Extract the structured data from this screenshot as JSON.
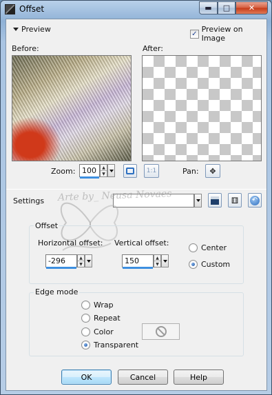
{
  "window": {
    "title": "Offset"
  },
  "preview": {
    "toggle_label": "Preview",
    "preview_on_image_label": "Preview on Image",
    "preview_on_image_checked": true,
    "before_label": "Before:",
    "after_label": "After:"
  },
  "zoom": {
    "label": "Zoom:",
    "value": "100",
    "fit_icon": "fit-to-window-icon",
    "actual_label": "1:1"
  },
  "pan": {
    "label": "Pan:",
    "icon": "move-arrows-icon"
  },
  "settings": {
    "label": "Settings",
    "preset_value": ""
  },
  "watermark": {
    "text": "Arte by_ Neusa Novaes"
  },
  "offset": {
    "legend": "Offset",
    "horizontal_label": "Horizontal offset:",
    "horizontal_value": "-296",
    "vertical_label": "Vertical offset:",
    "vertical_value": "150",
    "center_label": "Center",
    "custom_label": "Custom",
    "selected": "Custom"
  },
  "edge_mode": {
    "legend": "Edge mode",
    "options": [
      "Wrap",
      "Repeat",
      "Color",
      "Transparent"
    ],
    "selected": "Transparent"
  },
  "buttons": {
    "ok": "OK",
    "cancel": "Cancel",
    "help": "Help"
  },
  "colors": {
    "accent": "#3d8fe0",
    "title_bar": "#9fbde0",
    "close": "#c53a18"
  }
}
